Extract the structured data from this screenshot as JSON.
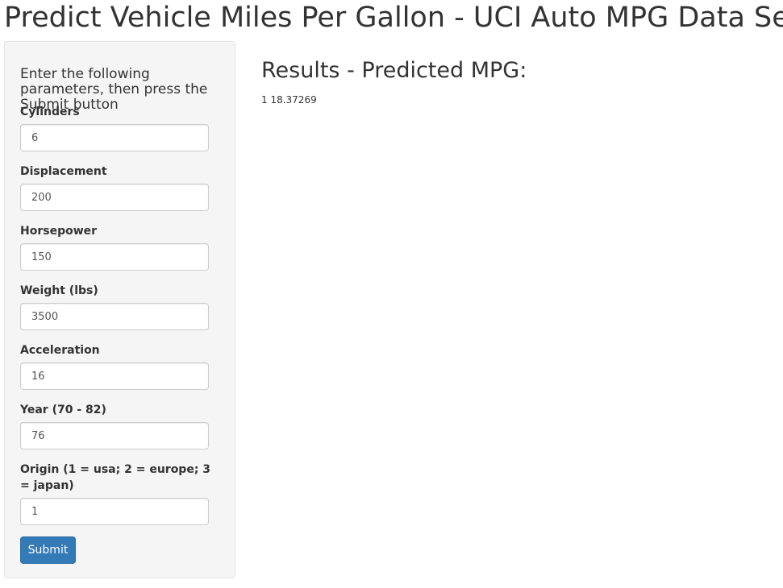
{
  "page": {
    "title": "Predict Vehicle Miles Per Gallon - UCI Auto MPG Data Set"
  },
  "sidebar": {
    "instructions": "Enter the following parameters, then press the Submit button",
    "fields": [
      {
        "label": "Cylinders",
        "value": "6"
      },
      {
        "label": "Displacement",
        "value": "200"
      },
      {
        "label": "Horsepower",
        "value": "150"
      },
      {
        "label": "Weight (lbs)",
        "value": "3500"
      },
      {
        "label": "Acceleration",
        "value": "16"
      },
      {
        "label": "Year (70 - 82)",
        "value": "76"
      },
      {
        "label": "Origin (1 = usa; 2 = europe; 3 = japan)",
        "value": "1"
      }
    ],
    "submit_label": "Submit"
  },
  "results": {
    "title": "Results - Predicted MPG:",
    "output": "1 18.37269"
  },
  "colors": {
    "primary_button": "#337ab7",
    "sidebar_background": "#f5f5f5"
  }
}
